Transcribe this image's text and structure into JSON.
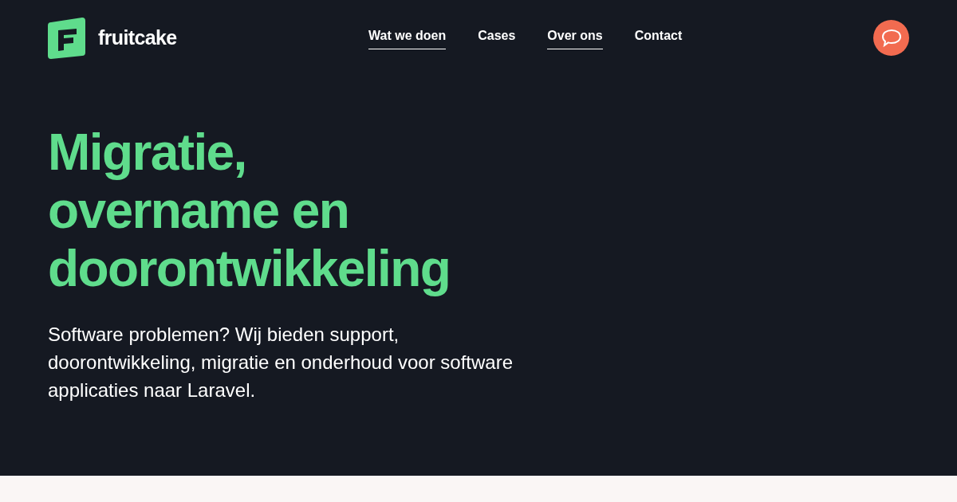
{
  "logo": {
    "text": "fruitcake"
  },
  "nav": [
    {
      "label": "Wat we doen",
      "underlined": true
    },
    {
      "label": "Cases",
      "underlined": false
    },
    {
      "label": "Over ons",
      "underlined": true
    },
    {
      "label": "Contact",
      "underlined": false
    }
  ],
  "hero": {
    "heading_lines": [
      "Migratie,",
      "overname en",
      "doorontwikkeling"
    ],
    "text": "Software problemen? Wij bieden support, doorontwikkeling, migratie en onderhoud voor software applicaties naar Laravel."
  }
}
